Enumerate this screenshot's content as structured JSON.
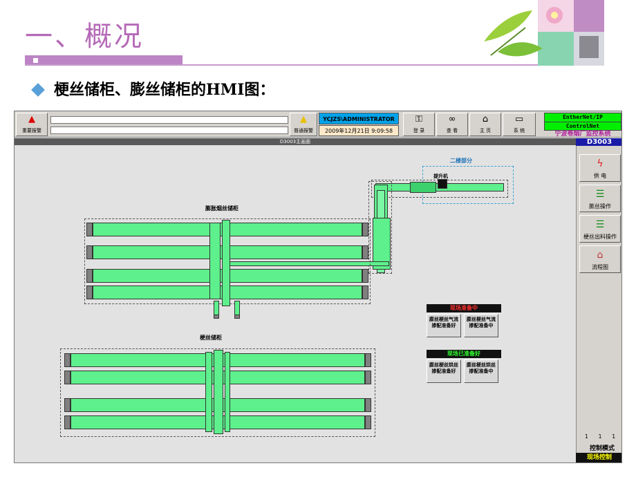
{
  "slide": {
    "title": "一、概况",
    "subtitle": "梗丝储柜、膨丝储柜的HMI图："
  },
  "hmi": {
    "toolbar": {
      "major_alarm_label": "重要报警",
      "normal_alarm_label": "普通报警",
      "user": "YCJZS\\ADMINISTRATOR",
      "datetime": "2009年12月21日  9:09:58",
      "login_label": "登 录",
      "view_label": "查 看",
      "home_label": "主 页",
      "system_label": "系 统",
      "network_1": "EntherNet/IP",
      "network_2": "ControlNet",
      "factory": "宁波卷烟厂监控系统"
    },
    "screen_title": "D3003主画面",
    "screen_id": "D3003",
    "side_menu": [
      {
        "label": "供 电",
        "icon": "lightning-icon"
      },
      {
        "label": "膨丝操作",
        "icon": "traffic-light-icon"
      },
      {
        "label": "梗丝出料操作",
        "icon": "traffic-light-icon"
      },
      {
        "label": "流程图",
        "icon": "flowchart-icon"
      }
    ],
    "mode": {
      "numbers": "1 1 1",
      "label": "控制模式",
      "value": "现场控制"
    },
    "process": {
      "second_floor_label": "二楼部分",
      "lift_label": "提升机",
      "expanded_cabinet_label": "膨胀烟丝储柜",
      "stem_cabinet_label": "梗丝储柜",
      "status_preparing": {
        "header": "现场准备中",
        "cells": [
          "膨丝梗丝气流掺配准备好",
          "膨丝梗丝气流掺配准备中"
        ]
      },
      "status_ready": {
        "header": "现场已准备好",
        "cells": [
          "膨丝梗丝烘丝掺配准备好",
          "膨丝梗丝烘丝掺配准备中"
        ]
      }
    },
    "colors": {
      "pipe": "#5ef08c",
      "preparing_header": "#ff3030",
      "ready_header": "#30ff30",
      "title_purple": "#b56ab7"
    }
  }
}
